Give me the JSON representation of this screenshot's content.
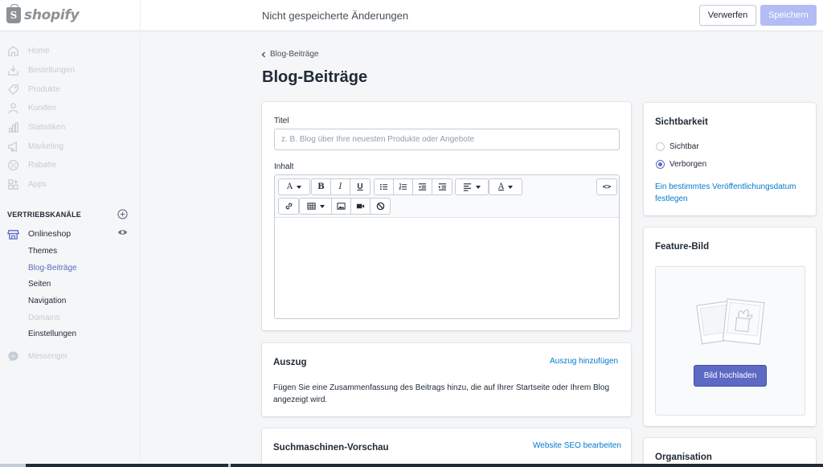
{
  "topbar": {
    "logo_text": "shopify",
    "logo_letter": "S",
    "unsaved_text": "Nicht gespeicherte Änderungen",
    "discard_label": "Verwerfen",
    "save_label": "Speichern"
  },
  "sidebar": {
    "items": [
      {
        "label": "Home",
        "icon": "home-icon"
      },
      {
        "label": "Bestellungen",
        "icon": "orders-icon"
      },
      {
        "label": "Produkte",
        "icon": "tag-icon"
      },
      {
        "label": "Kunden",
        "icon": "person-icon"
      },
      {
        "label": "Statistiken",
        "icon": "bar-chart-icon"
      },
      {
        "label": "Marketing",
        "icon": "megaphone-icon"
      },
      {
        "label": "Rabatte",
        "icon": "discount-icon"
      },
      {
        "label": "Apps",
        "icon": "apps-icon"
      }
    ],
    "section_title": "VERTRIEBSKANÄLE",
    "channel": {
      "label": "Onlineshop",
      "icon": "store-icon"
    },
    "sub_items": [
      {
        "label": "Themes",
        "state": "normal"
      },
      {
        "label": "Blog-Beiträge",
        "state": "active"
      },
      {
        "label": "Seiten",
        "state": "normal"
      },
      {
        "label": "Navigation",
        "state": "normal"
      },
      {
        "label": "Domains",
        "state": "disabled"
      },
      {
        "label": "Einstellungen",
        "state": "normal"
      }
    ],
    "messenger": {
      "label": "Messenger",
      "icon": "messenger-icon"
    }
  },
  "main": {
    "breadcrumb": "Blog-Beiträge",
    "page_title": "Blog-Beiträge",
    "post": {
      "title_label": "Titel",
      "title_placeholder": "z. B. Blog über Ihre neuesten Produkte oder Angebote",
      "content_label": "Inhalt",
      "toolbar": {
        "row1": [
          "text-style-dropdown",
          "bold",
          "italic",
          "underline",
          "bullet-list",
          "numbered-list",
          "outdent",
          "indent",
          "align-dropdown",
          "text-color-dropdown"
        ],
        "row1_glyphs": {
          "text_style": "A",
          "bold": "B",
          "italic": "I",
          "underline": "U",
          "text_color": "A"
        },
        "row2": [
          "link",
          "table-dropdown",
          "image",
          "video",
          "clear-formatting"
        ],
        "html_toggle": "<>"
      }
    },
    "excerpt": {
      "title": "Auszug",
      "add_link": "Auszug hinzufügen",
      "description": "Fügen Sie eine Zusammenfassung des Beitrags hinzu, die auf Ihrer Startseite oder Ihrem Blog angezeigt wird."
    },
    "seo": {
      "title": "Suchmaschinen-Vorschau",
      "edit_link": "Website SEO bearbeiten"
    },
    "visibility": {
      "title": "Sichtbarkeit",
      "options": [
        {
          "label": "Sichtbar",
          "checked": false
        },
        {
          "label": "Verborgen",
          "checked": true
        }
      ],
      "schedule_link": "Ein bestimmtes Veröffentlichungsdatum festlegen"
    },
    "feature_image": {
      "title": "Feature-Bild",
      "upload_label": "Bild hochladen"
    },
    "organisation": {
      "title": "Organisation"
    }
  },
  "colors": {
    "accent": "#5c6ac4",
    "link": "#007ace",
    "save_disabled": "#b3bcf5"
  }
}
